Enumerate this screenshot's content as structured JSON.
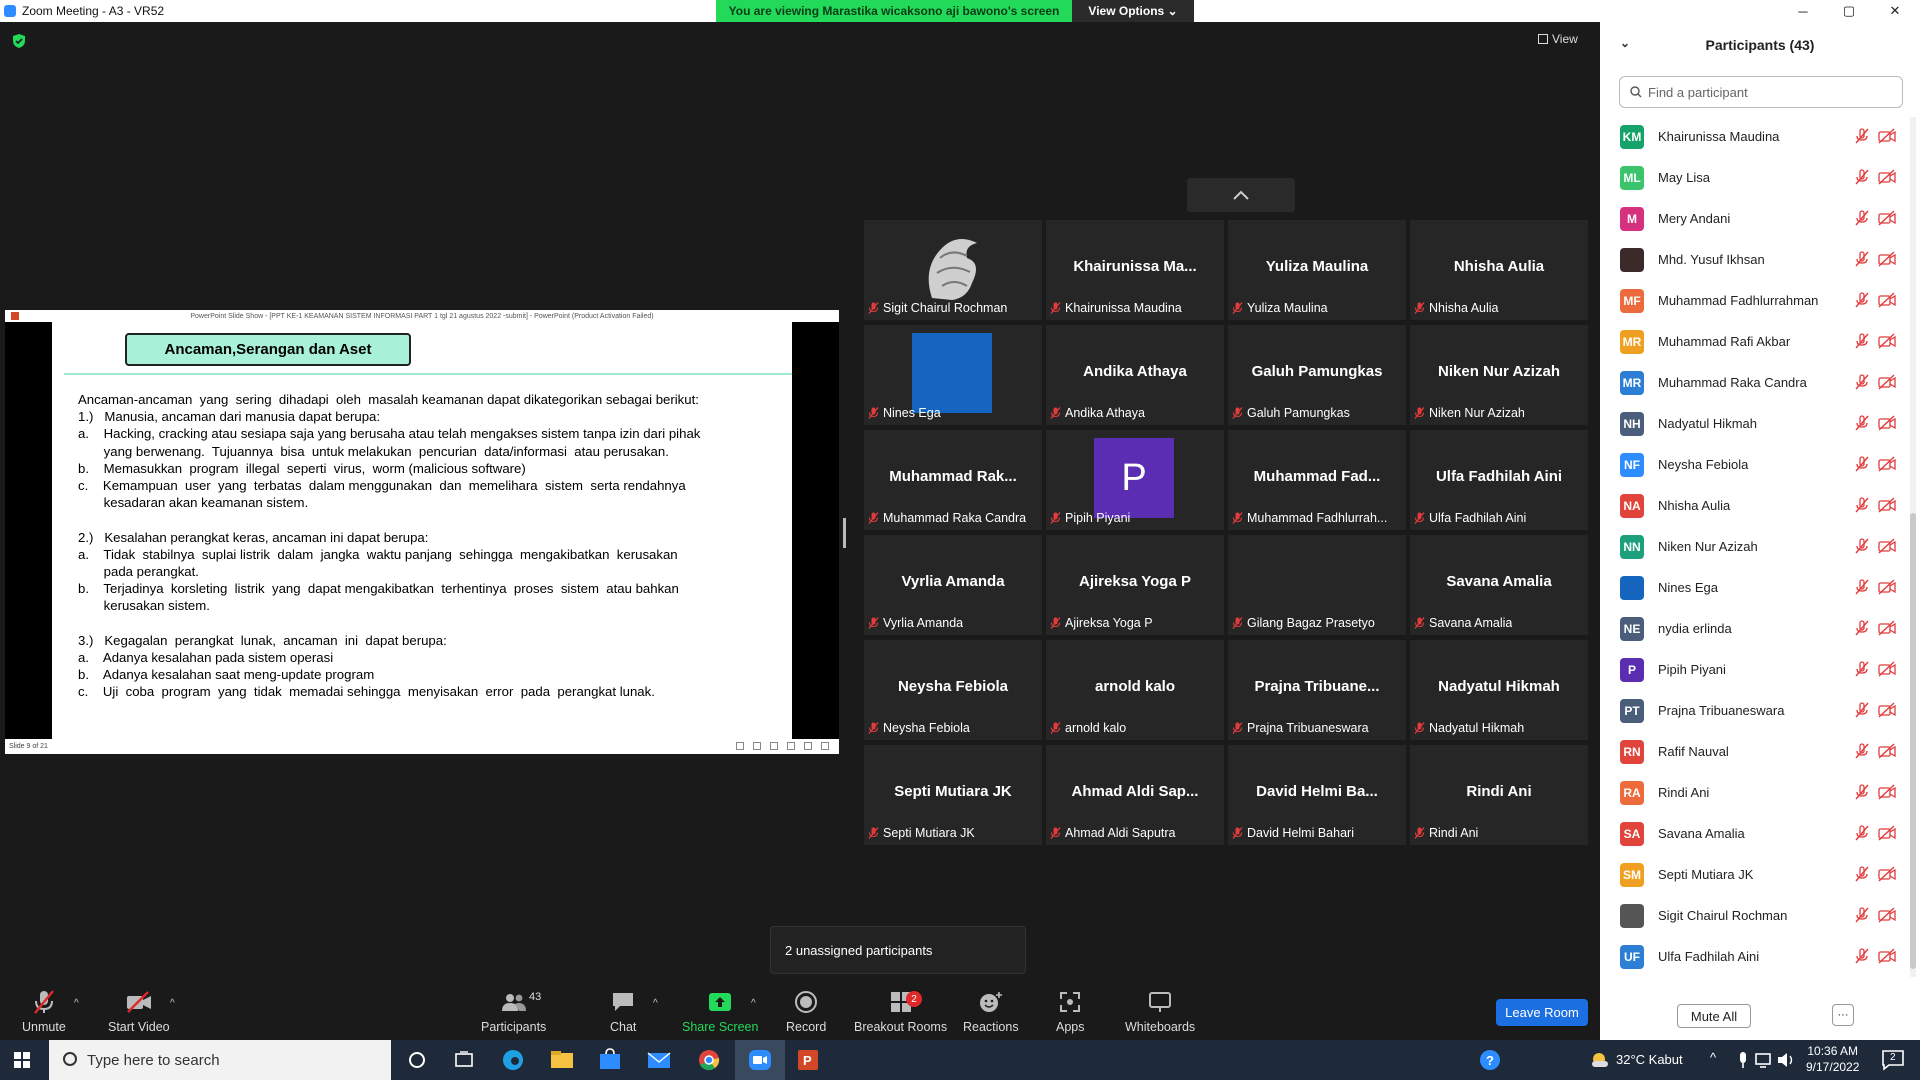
{
  "window": {
    "title": "Zoom Meeting - A3 - VR52",
    "minimize": "─",
    "maximize": "▢",
    "close": "✕"
  },
  "banner": {
    "viewing_text": "You are viewing Marastika wicaksono aji bawono's screen",
    "view_options": "View Options ⌄"
  },
  "top_view_label": "View",
  "slide": {
    "window_title": "PowerPoint Slide Show - [PPT KE-1 KEAMANAN SISTEM INFORMASI PART 1 tgl 21 agustus 2022 -submit] - PowerPoint (Product Activation Failed)",
    "title": "Ancaman,Serangan dan Aset",
    "lines": [
      "Ancaman-ancaman  yang  sering  dihadapi  oleh  masalah keamanan dapat dikategorikan sebagai berikut:",
      "1.)   Manusia, ancaman dari manusia dapat berupa:",
      "a.    Hacking, cracking atau sesiapa saja yang berusaha atau telah mengakses sistem tanpa izin dari pihak",
      "       yang berwenang.  Tujuannya  bisa  untuk melakukan  pencurian  data/informasi  atau perusakan.",
      "b.    Memasukkan  program  illegal  seperti  virus,  worm (malicious software)",
      "c.    Kemampuan  user  yang  terbatas  dalam menggunakan  dan  memelihara  sistem  serta rendahnya",
      "       kesadaran akan keamanan sistem.",
      "",
      "2.)   Kesalahan perangkat keras, ancaman ini dapat berupa:",
      "a.    Tidak  stabilnya  suplai listrik  dalam  jangka  waktu panjang  sehingga  mengakibatkan  kerusakan",
      "       pada perangkat.",
      "b.    Terjadinya  korsleting  listrik  yang  dapat mengakibatkan  terhentinya  proses  sistem  atau bahkan",
      "       kerusakan sistem.",
      "",
      "3.)   Kegagalan  perangkat  lunak,  ancaman  ini  dapat berupa:",
      "a.    Adanya kesalahan pada sistem operasi",
      "b.    Adanya kesalahan saat meng-update program",
      "c.    Uji  coba  program  yang  tidak  memadai sehingga  menyisakan  error  pada  perangkat lunak."
    ],
    "status": "Slide 9 of 21"
  },
  "gallery": {
    "tiles": [
      {
        "name": "",
        "label": "Sigit Chairul Rochman",
        "type": "photo"
      },
      {
        "name": "Khairunissa  Ma...",
        "label": "Khairunissa Maudina",
        "type": "text"
      },
      {
        "name": "Yuliza Maulina",
        "label": "Yuliza Maulina",
        "type": "text"
      },
      {
        "name": "Nhisha Aulia",
        "label": "Nhisha Aulia",
        "type": "text"
      },
      {
        "name": "",
        "label": "Nines Ega",
        "type": "blue"
      },
      {
        "name": "Andika Athaya",
        "label": "Andika Athaya",
        "type": "text"
      },
      {
        "name": "Galuh Pamungkas",
        "label": "Galuh Pamungkas",
        "type": "text"
      },
      {
        "name": "Niken Nur Azizah",
        "label": "Niken Nur Azizah",
        "type": "text"
      },
      {
        "name": "Muhammad  Rak...",
        "label": "Muhammad Raka Candra",
        "type": "text"
      },
      {
        "name": "P",
        "label": "Pipih Piyani",
        "type": "purple"
      },
      {
        "name": "Muhammad  Fad...",
        "label": "Muhammad Fadhlurrah...",
        "type": "text"
      },
      {
        "name": "Ulfa Fadhilah Aini",
        "label": "Ulfa Fadhilah Aini",
        "type": "text"
      },
      {
        "name": "Vyrlia Amanda",
        "label": "Vyrlia Amanda",
        "type": "text"
      },
      {
        "name": "Ajireksa Yoga P",
        "label": "Ajireksa Yoga P",
        "type": "text"
      },
      {
        "name": "",
        "label": "Gilang Bagaz Prasetyo",
        "type": "text"
      },
      {
        "name": "Savana Amalia",
        "label": "Savana Amalia",
        "type": "text"
      },
      {
        "name": "Neysha Febiola",
        "label": "Neysha Febiola",
        "type": "text"
      },
      {
        "name": "arnold kalo",
        "label": "arnold kalo",
        "type": "text"
      },
      {
        "name": "Prajna  Tribuane...",
        "label": "Prajna Tribuaneswara",
        "type": "text"
      },
      {
        "name": "Nadyatul Hikmah",
        "label": "Nadyatul Hikmah",
        "type": "text"
      },
      {
        "name": "Septi Mutiara JK",
        "label": "Septi Mutiara JK",
        "type": "text"
      },
      {
        "name": "Ahmad  Aldi  Sap...",
        "label": "Ahmad Aldi Saputra",
        "type": "text"
      },
      {
        "name": "David  Helmi  Ba...",
        "label": "David Helmi Bahari",
        "type": "text"
      },
      {
        "name": "Rindi Ani",
        "label": "Rindi Ani",
        "type": "text"
      }
    ]
  },
  "toast": "2 unassigned participants",
  "toolbar": {
    "unmute": "Unmute",
    "start_video": "Start Video",
    "participants": "Participants",
    "participants_count": "43",
    "chat": "Chat",
    "share_screen": "Share Screen",
    "record": "Record",
    "breakout_rooms": "Breakout Rooms",
    "breakout_badge": "2",
    "reactions": "Reactions",
    "apps": "Apps",
    "whiteboards": "Whiteboards",
    "leave_room": "Leave Room"
  },
  "panel": {
    "title": "Participants (43)",
    "search_placeholder": "Find a participant",
    "participants": [
      {
        "initials": "KM",
        "name": "Khairunissa Maudina",
        "color": "#16a36a"
      },
      {
        "initials": "ML",
        "name": "May Lisa",
        "color": "#3cc46d"
      },
      {
        "initials": "M",
        "name": "Mery Andani",
        "color": "#d6317e"
      },
      {
        "initials": "",
        "name": "Mhd. Yusuf Ikhsan",
        "color": "#3b2a2a"
      },
      {
        "initials": "MF",
        "name": "Muhammad Fadhlurrahman",
        "color": "#ec6a3c"
      },
      {
        "initials": "MR",
        "name": "Muhammad Rafi Akbar",
        "color": "#f0a020"
      },
      {
        "initials": "MR",
        "name": "Muhammad Raka Candra",
        "color": "#2d7fd6"
      },
      {
        "initials": "NH",
        "name": "Nadyatul Hikmah",
        "color": "#4a5d7a"
      },
      {
        "initials": "NF",
        "name": "Neysha Febiola",
        "color": "#2d8cff"
      },
      {
        "initials": "NA",
        "name": "Nhisha Aulia",
        "color": "#e0443a"
      },
      {
        "initials": "NN",
        "name": "Niken Nur Azizah",
        "color": "#1ca07c"
      },
      {
        "initials": "",
        "name": "Nines Ega",
        "color": "#1565c0"
      },
      {
        "initials": "NE",
        "name": "nydia erlinda",
        "color": "#4a5d7a"
      },
      {
        "initials": "P",
        "name": "Pipih Piyani",
        "color": "#5b2db3"
      },
      {
        "initials": "PT",
        "name": "Prajna Tribuaneswara",
        "color": "#4a5d7a"
      },
      {
        "initials": "RN",
        "name": "Rafif Nauval",
        "color": "#e0443a"
      },
      {
        "initials": "RA",
        "name": "Rindi Ani",
        "color": "#ec6a3c"
      },
      {
        "initials": "SA",
        "name": "Savana Amalia",
        "color": "#e0443a"
      },
      {
        "initials": "SM",
        "name": "Septi Mutiara JK",
        "color": "#f0a020"
      },
      {
        "initials": "",
        "name": "Sigit Chairul Rochman",
        "color": "#555555"
      },
      {
        "initials": "UF",
        "name": "Ulfa Fadhilah Aini",
        "color": "#2d7fd6"
      }
    ],
    "mute_all": "Mute All",
    "more": "···"
  },
  "taskbar": {
    "search_placeholder": "Type here to search",
    "weather": "32°C  Kabut",
    "time": "10:36 AM",
    "date": "9/17/2022",
    "notif_count": "2"
  }
}
